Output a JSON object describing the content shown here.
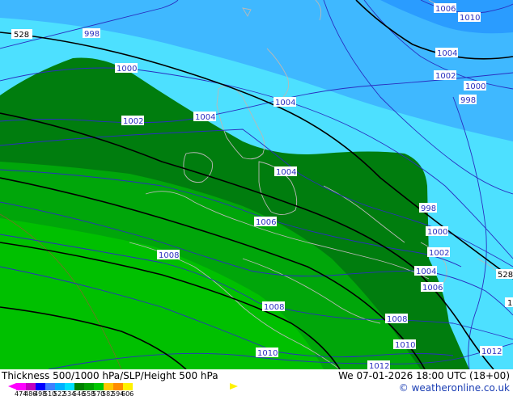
{
  "footer": {
    "title": "Thickness 500/1000 hPa/SLP/Height 500 hPa",
    "valid_time": "We 07-01-2026 18:00 UTC (18+00)",
    "credit": "© weatheronline.co.uk"
  },
  "legend": {
    "tick_labels": [
      "474",
      "486",
      "498",
      "510",
      "522",
      "534",
      "546",
      "558",
      "570",
      "582",
      "594",
      "606"
    ],
    "colors": [
      "#ff00ff",
      "#c000c0",
      "#0000ff",
      "#3f7fff",
      "#00b0ff",
      "#00e0ff",
      "#008000",
      "#00a000",
      "#00c800",
      "#ffc800",
      "#ff8c00",
      "#fff200"
    ]
  },
  "map": {
    "colors": {
      "light_blue_band": "#3fb8ff",
      "cyan_band": "#4de0ff",
      "dark_green_band": "#007d0e",
      "mid_green_band": "#00a60a",
      "bright_green_band": "#00c000",
      "isobar": "#2a2fc0",
      "thickness_line": "#000000",
      "coastline": "#b8b8b8",
      "grid_red": "#c04040"
    },
    "isobar_labels": [
      "1006",
      "1010",
      "998",
      "1000",
      "1004",
      "1002",
      "1000",
      "998",
      "1004",
      "1002",
      "1004",
      "1004",
      "998",
      "1006",
      "1000",
      "1008",
      "1002",
      "1004",
      "1006",
      "1008",
      "1008",
      "1010",
      "1010",
      "1012",
      "1012"
    ],
    "thickness_labels": [
      "528",
      "528",
      "1"
    ]
  }
}
